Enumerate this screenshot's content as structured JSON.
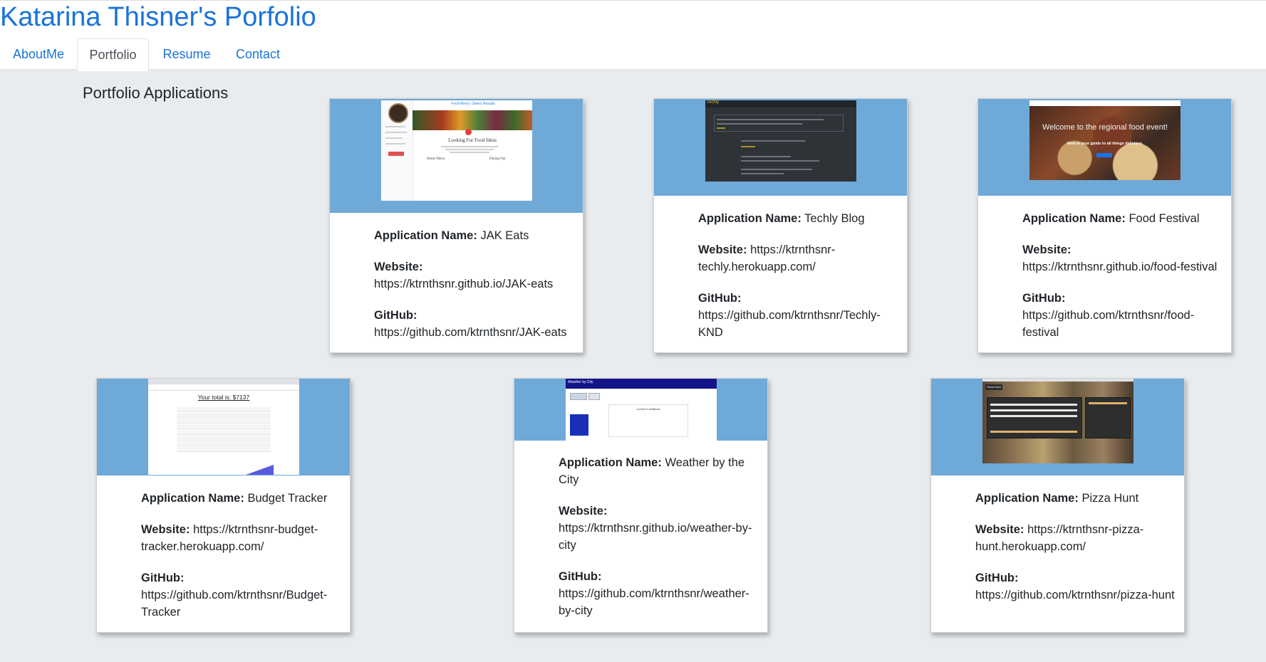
{
  "site": {
    "title": "Katarina Thisner's Porfolio"
  },
  "tabs": [
    {
      "label": "AboutMe",
      "active": false
    },
    {
      "label": "Portfolio",
      "active": true
    },
    {
      "label": "Resume",
      "active": false
    },
    {
      "label": "Contact",
      "active": false
    }
  ],
  "section_title": "Portfolio Applications",
  "labels": {
    "app_name": "Application Name:",
    "website": "Website:",
    "github": "GitHub:"
  },
  "colors": {
    "link": "#1a73d9",
    "thumb_band": "#6fa9d8",
    "page_bg": "#e9ecef"
  },
  "projects": [
    {
      "name": "JAK Eats",
      "website": "https://ktrnthsnr.github.io/JAK-eats",
      "github": "https://github.com/ktrnthsnr/JAK-eats",
      "thumb": {
        "header": "Food Menu | Select Results",
        "heading": "Looking For Food Ideas",
        "left": "Home Menu",
        "right": "Dining Out"
      }
    },
    {
      "name": "Techly Blog",
      "website": "https://ktrnthsnr-techly.herokuapp.com/",
      "github": "https://github.com/ktrnthsnr/Techly-KND",
      "thumb": {
        "logo": "Techly"
      }
    },
    {
      "name": "Food Festival",
      "website": "https://ktrnthsnr.github.io/food-festival",
      "github": "https://github.com/ktrnthsnr/food-festival",
      "thumb": {
        "heading": "Welcome to the regional food event!",
        "sub": "Here is your guide to all things delicious."
      }
    },
    {
      "name": "Budget Tracker",
      "website": "https://ktrnthsnr-budget-tracker.herokuapp.com/",
      "github": "https://github.com/ktrnthsnr/Budget-Tracker",
      "thumb": {
        "total": "Your total is: $7137"
      }
    },
    {
      "name": "Weather by the City",
      "website": "https://ktrnthsnr.github.io/weather-by-city",
      "github": "https://github.com/ktrnthsnr/weather-by-city",
      "thumb": {
        "nav": "Weather by City",
        "panel": "Current Conditions"
      }
    },
    {
      "name": "Pizza Hunt",
      "website": "https://ktrnthsnr-pizza-hunt.herokuapp.com/",
      "github": "https://github.com/ktrnthsnr/pizza-hunt",
      "thumb": {
        "logo": "Pizza Hunt"
      }
    }
  ]
}
